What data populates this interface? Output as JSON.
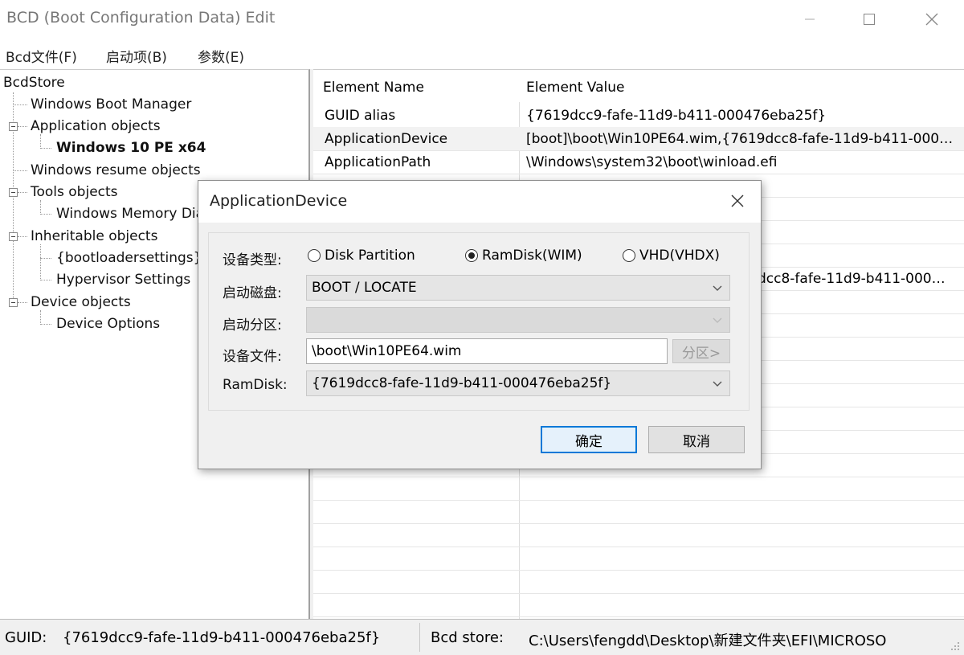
{
  "window": {
    "title": "BCD (Boot Configuration Data) Edit"
  },
  "menu": [
    "Bcd文件(F)",
    "启动项(B)",
    "参数(E)"
  ],
  "tree": {
    "root": "BcdStore",
    "nodes": [
      "Windows Boot Manager",
      "Application objects",
      "Windows 10 PE x64",
      "Windows resume objects",
      "Tools objects",
      "Windows Memory Dia",
      "Inheritable objects",
      "{bootloadersettings}",
      "Hypervisor Settings",
      "Device objects",
      "Device Options"
    ]
  },
  "grid": {
    "col_name": "Element Name",
    "col_value": "Element Value",
    "rows": [
      {
        "name": "GUID alias",
        "value": "{7619dcc9-fafe-11d9-b411-000476eba25f}"
      },
      {
        "name": "ApplicationDevice",
        "value": "[boot]\\boot\\Win10PE64.wim,{7619dcc8-fafe-11d9-b411-000…"
      },
      {
        "name": "ApplicationPath",
        "value": "\\Windows\\system32\\boot\\winload.efi"
      }
    ],
    "partial_value": "dcc8-fafe-11d9-b411-000…"
  },
  "dialog": {
    "title": "ApplicationDevice",
    "device_type_label": "设备类型:",
    "radios": [
      {
        "label": "Disk Partition",
        "checked": false
      },
      {
        "label": "RamDisk(WIM)",
        "checked": true
      },
      {
        "label": "VHD(VHDX)",
        "checked": false
      }
    ],
    "boot_disk_label": "启动磁盘:",
    "boot_disk_value": "BOOT / LOCATE",
    "boot_partition_label": "启动分区:",
    "boot_partition_value": "",
    "device_file_label": "设备文件:",
    "device_file_value": "\\boot\\Win10PE64.wim",
    "partition_button": "分区>",
    "ramdisk_label": "RamDisk:",
    "ramdisk_value": "{7619dcc8-fafe-11d9-b411-000476eba25f}",
    "ok_button": "确定",
    "cancel_button": "取消"
  },
  "status": {
    "guid_label": "GUID:",
    "guid_value": "{7619dcc9-fafe-11d9-b411-000476eba25f}",
    "store_label": "Bcd store:",
    "store_value": "C:\\Users\\fengdd\\Desktop\\新建文件夹\\EFI\\MICROSO"
  },
  "colors": {
    "accent": "#0078d7",
    "selected_row": "#f2f2f2"
  }
}
